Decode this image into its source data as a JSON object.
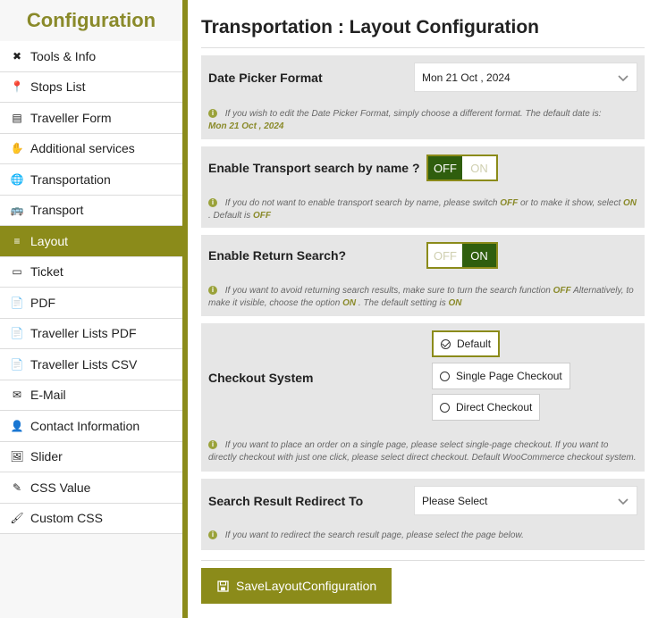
{
  "sidebar": {
    "title": "Configuration",
    "items": [
      {
        "label": "Tools & Info",
        "icon": "tools-icon",
        "glyph": "✖"
      },
      {
        "label": "Stops List",
        "icon": "map-pin-icon",
        "glyph": "📍"
      },
      {
        "label": "Traveller Form",
        "icon": "form-icon",
        "glyph": "▤"
      },
      {
        "label": "Additional services",
        "icon": "service-hand-icon",
        "glyph": "✋"
      },
      {
        "label": "Transportation",
        "icon": "globe-icon",
        "glyph": "🌐"
      },
      {
        "label": "Transport",
        "icon": "bus-icon",
        "glyph": "🚌"
      },
      {
        "label": "Layout",
        "icon": "layers-icon",
        "glyph": "≡"
      },
      {
        "label": "Ticket",
        "icon": "ticket-icon",
        "glyph": "▭"
      },
      {
        "label": "PDF",
        "icon": "pdf-file-icon",
        "glyph": "📄"
      },
      {
        "label": "Traveller Lists PDF",
        "icon": "file-icon",
        "glyph": "📄"
      },
      {
        "label": "Traveller Lists CSV",
        "icon": "csv-file-icon",
        "glyph": "📄"
      },
      {
        "label": "E-Mail",
        "icon": "envelope-icon",
        "glyph": "✉"
      },
      {
        "label": "Contact Information",
        "icon": "contact-icon",
        "glyph": "👤"
      },
      {
        "label": "Slider",
        "icon": "images-icon",
        "glyph": "🖼"
      },
      {
        "label": "CSS Value",
        "icon": "css-tool-icon",
        "glyph": "✎"
      },
      {
        "label": "Custom CSS",
        "icon": "brush-icon",
        "glyph": "🖌"
      }
    ],
    "active_index": 6
  },
  "main": {
    "title": "Transportation : Layout Configuration",
    "date_picker": {
      "label": "Date Picker Format",
      "value": "Mon 21 Oct , 2024",
      "note": "If you wish to edit the Date Picker Format, simply choose a different format. The default date is:",
      "note_highlight": "Mon 21 Oct , 2024"
    },
    "transport_search": {
      "label": "Enable Transport search by name ?",
      "off": "OFF",
      "on": "ON",
      "note_1": "If you do not want to enable transport search by name, please switch",
      "hl_off": "OFF",
      "note_2": "or to make it show, select",
      "hl_on": "ON",
      "note_3": ". Default is",
      "hl_default": "OFF"
    },
    "return_search": {
      "label": "Enable Return Search?",
      "off": "OFF",
      "on": "ON",
      "note_1": "If you want to avoid returning search results, make sure to turn the search function",
      "hl_off": "OFF",
      "note_2": "Alternatively, to make it visible, choose the option",
      "hl_on": "ON",
      "note_3": ". The default setting is",
      "hl_default": "ON"
    },
    "checkout": {
      "label": "Checkout System",
      "options": [
        "Default",
        "Single Page Checkout",
        "Direct Checkout"
      ],
      "selected": "Default",
      "note": "If you want to place an order on a single page, please select single-page checkout. If you want to directly checkout with just one click, please select direct checkout. Default WooCommerce checkout system."
    },
    "redirect": {
      "label": "Search Result Redirect To",
      "value": "Please Select",
      "note": "If you want to redirect the search result page, please select the page below."
    },
    "save_label": "SaveLayoutConfiguration"
  }
}
